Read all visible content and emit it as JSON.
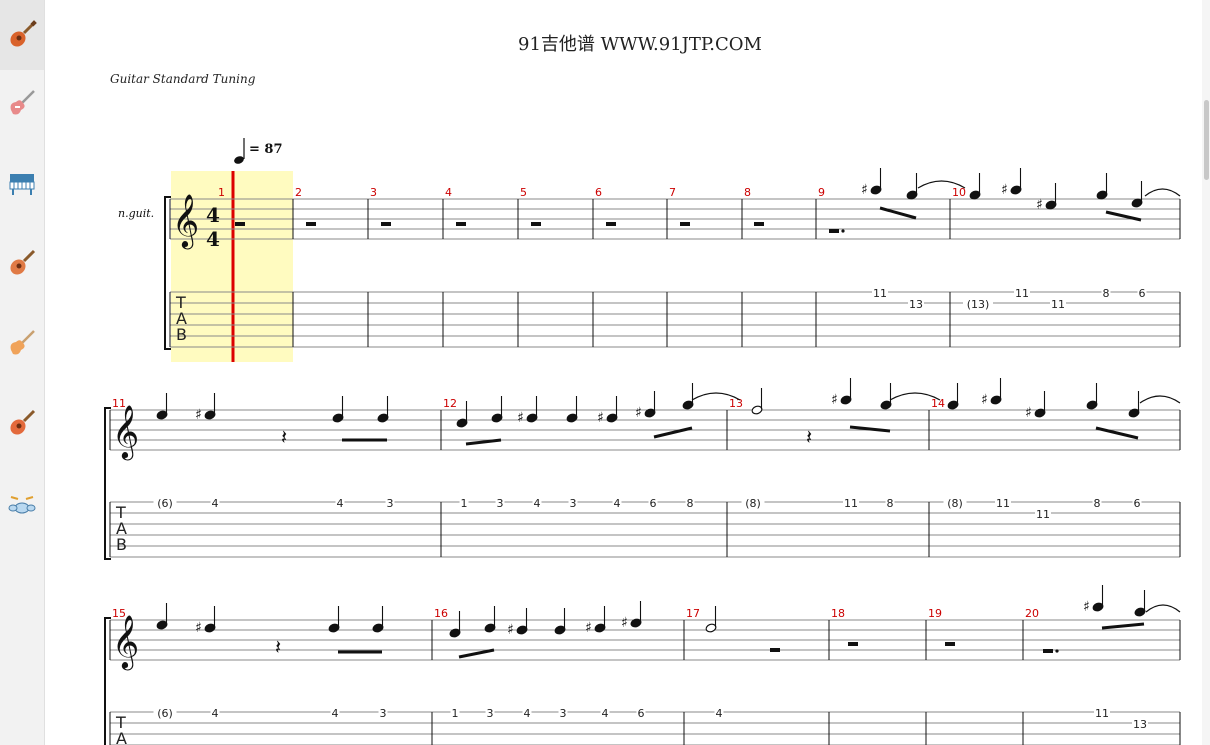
{
  "page": {
    "title": "91吉他谱 WWW.91JTP.COM"
  },
  "header": {
    "tuning": "Guitar Standard Tuning",
    "tempo_value": "= 87",
    "instrument": "n.guit."
  },
  "sidebar": {
    "items": [
      {
        "icon": "acoustic-guitar-icon",
        "active": true
      },
      {
        "icon": "electric-guitar-icon",
        "active": false
      },
      {
        "icon": "piano-icon",
        "active": false
      },
      {
        "icon": "acoustic-guitar-icon",
        "active": false
      },
      {
        "icon": "electric-guitar-icon",
        "active": false
      },
      {
        "icon": "acoustic-guitar-icon",
        "active": false
      },
      {
        "icon": "drum-kit-icon",
        "active": false
      }
    ]
  },
  "colors": {
    "measure_number": "#cc0000",
    "cursor": "#dd0000",
    "highlight": "#fffbc0",
    "ink": "#111111"
  },
  "time_signature": {
    "top": "4",
    "bottom": "4"
  },
  "tab_letters": [
    "T",
    "A",
    "B"
  ],
  "systems": [
    {
      "measures": [
        {
          "number": "1",
          "tab": []
        },
        {
          "number": "2",
          "tab": []
        },
        {
          "number": "3",
          "tab": []
        },
        {
          "number": "4",
          "tab": []
        },
        {
          "number": "5",
          "tab": []
        },
        {
          "number": "6",
          "tab": []
        },
        {
          "number": "7",
          "tab": []
        },
        {
          "number": "8",
          "tab": []
        },
        {
          "number": "9",
          "tab": [
            {
              "string": 1,
              "fret": "11"
            },
            {
              "string": 2,
              "fret": "13"
            }
          ]
        },
        {
          "number": "10",
          "tab": [
            {
              "string": 2,
              "fret": "(13)"
            },
            {
              "string": 1,
              "fret": "11"
            },
            {
              "string": 2,
              "fret": "11"
            },
            {
              "string": 1,
              "fret": "8"
            },
            {
              "string": 1,
              "fret": "6"
            }
          ]
        }
      ]
    },
    {
      "measures": [
        {
          "number": "11",
          "tab": [
            {
              "string": 1,
              "fret": "(6)"
            },
            {
              "string": 1,
              "fret": "4"
            },
            {
              "string": 1,
              "fret": "4"
            },
            {
              "string": 1,
              "fret": "3"
            }
          ]
        },
        {
          "number": "12",
          "tab": [
            {
              "string": 1,
              "fret": "1"
            },
            {
              "string": 1,
              "fret": "3"
            },
            {
              "string": 1,
              "fret": "4"
            },
            {
              "string": 1,
              "fret": "3"
            },
            {
              "string": 1,
              "fret": "4"
            },
            {
              "string": 1,
              "fret": "6"
            },
            {
              "string": 1,
              "fret": "8"
            }
          ]
        },
        {
          "number": "13",
          "tab": [
            {
              "string": 1,
              "fret": "(8)"
            },
            {
              "string": 1,
              "fret": "11"
            },
            {
              "string": 1,
              "fret": "8"
            }
          ]
        },
        {
          "number": "14",
          "tab": [
            {
              "string": 1,
              "fret": "(8)"
            },
            {
              "string": 1,
              "fret": "11"
            },
            {
              "string": 2,
              "fret": "11"
            },
            {
              "string": 1,
              "fret": "8"
            },
            {
              "string": 1,
              "fret": "6"
            }
          ]
        }
      ]
    },
    {
      "measures": [
        {
          "number": "15",
          "tab": [
            {
              "string": 1,
              "fret": "(6)"
            },
            {
              "string": 1,
              "fret": "4"
            },
            {
              "string": 1,
              "fret": "4"
            },
            {
              "string": 1,
              "fret": "3"
            }
          ]
        },
        {
          "number": "16",
          "tab": [
            {
              "string": 1,
              "fret": "1"
            },
            {
              "string": 1,
              "fret": "3"
            },
            {
              "string": 1,
              "fret": "4"
            },
            {
              "string": 1,
              "fret": "3"
            },
            {
              "string": 1,
              "fret": "4"
            },
            {
              "string": 1,
              "fret": "6"
            }
          ]
        },
        {
          "number": "17",
          "tab": [
            {
              "string": 1,
              "fret": "4"
            }
          ]
        },
        {
          "number": "18",
          "tab": []
        },
        {
          "number": "19",
          "tab": []
        },
        {
          "number": "20",
          "tab": [
            {
              "string": 1,
              "fret": "11"
            },
            {
              "string": 2,
              "fret": "13"
            }
          ]
        }
      ]
    }
  ]
}
